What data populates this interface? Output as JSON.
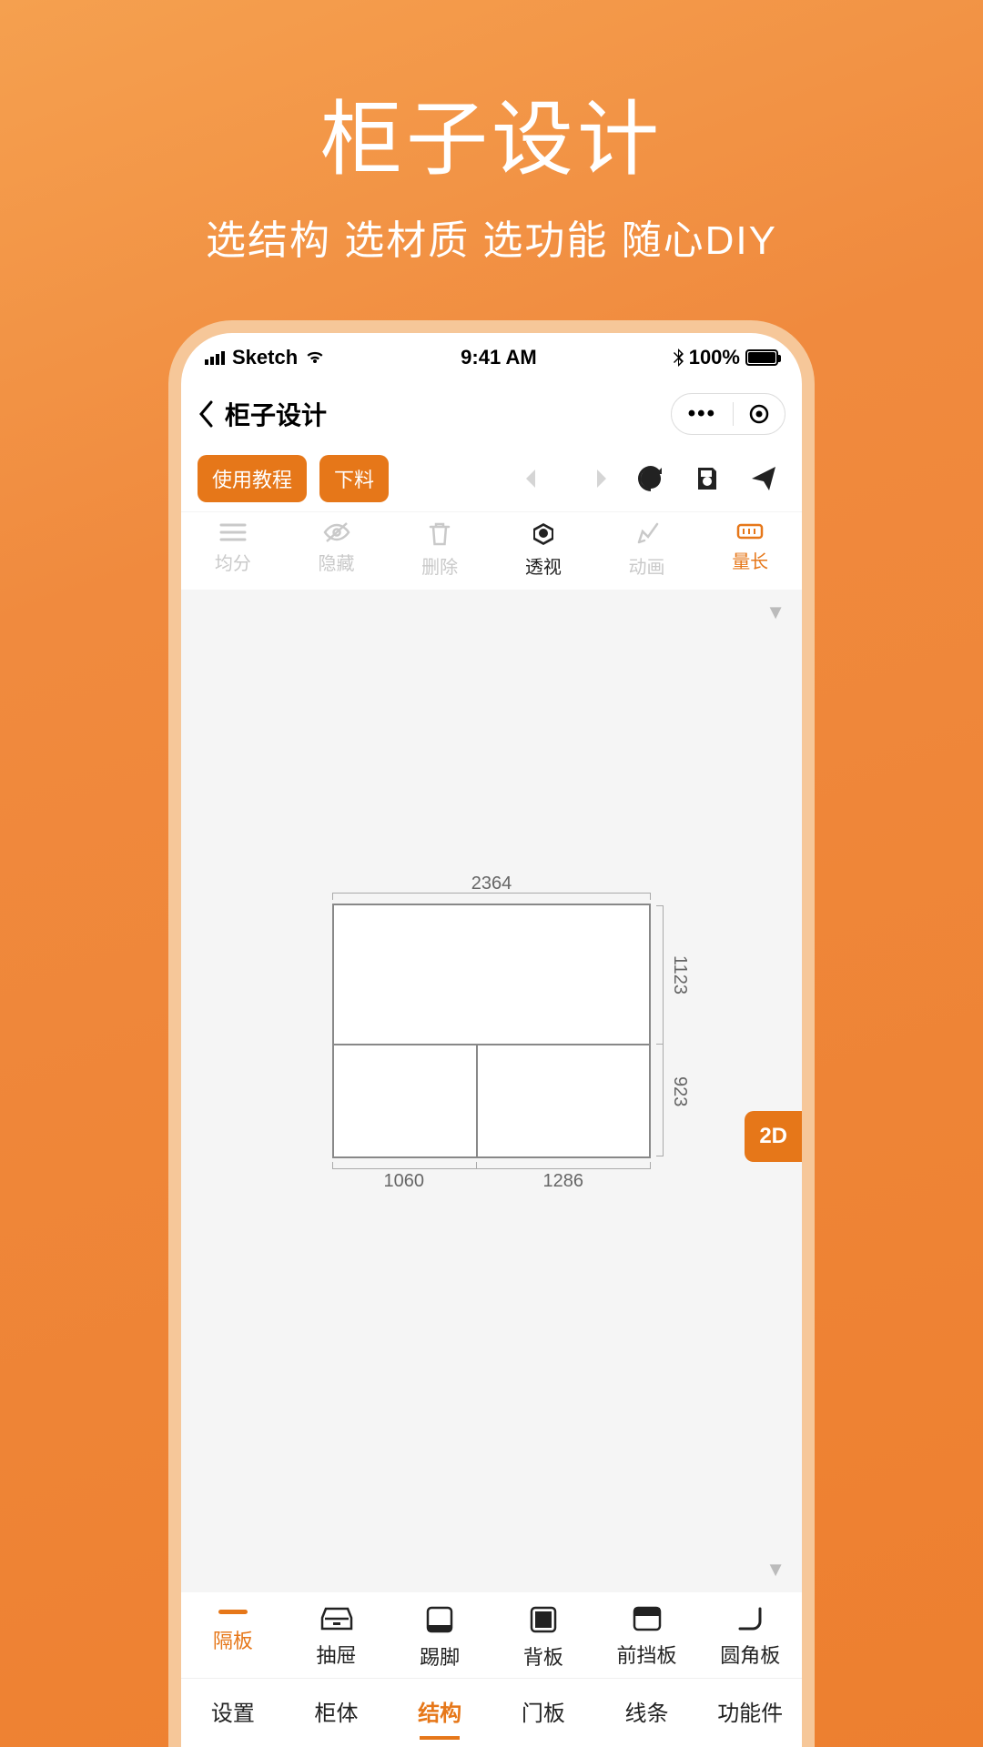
{
  "promo": {
    "title": "柜子设计",
    "subtitle": "选结构 选材质 选功能 随心DIY"
  },
  "status": {
    "carrier": "Sketch",
    "time": "9:41 AM",
    "battery": "100%"
  },
  "nav": {
    "title": "柜子设计",
    "dots": "•••"
  },
  "actions": {
    "tutorial": "使用教程",
    "cut": "下料"
  },
  "tools": {
    "divide": "均分",
    "hide": "隐藏",
    "delete": "删除",
    "perspective": "透视",
    "animate": "动画",
    "measure": "量长"
  },
  "canvas": {
    "badge": "2D",
    "dims": {
      "top": "2364",
      "bottom_left": "1060",
      "bottom_right": "1286",
      "right_top": "1123",
      "right_bottom": "923"
    }
  },
  "categories": {
    "partition": "隔板",
    "drawer": "抽屉",
    "kick": "踢脚",
    "back": "背板",
    "front": "前挡板",
    "round": "圆角板"
  },
  "tabs": {
    "settings": "设置",
    "body": "柜体",
    "structure": "结构",
    "door": "门板",
    "line": "线条",
    "function": "功能件"
  }
}
